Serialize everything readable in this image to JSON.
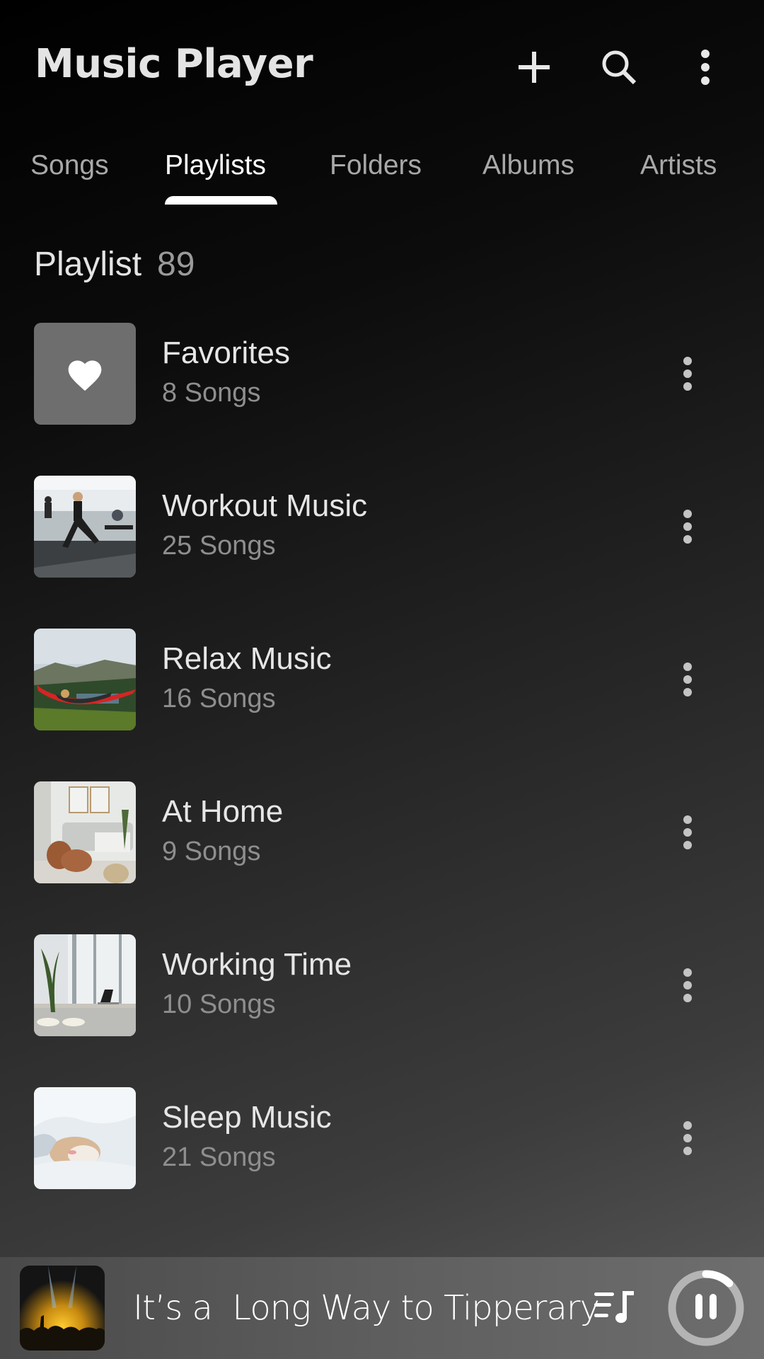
{
  "header": {
    "title": "Music Player",
    "actions": [
      {
        "name": "add",
        "icon": "plus-icon"
      },
      {
        "name": "search",
        "icon": "search-icon"
      },
      {
        "name": "more",
        "icon": "more-vert-icon"
      }
    ]
  },
  "tabs": [
    {
      "label": "Songs",
      "active": false
    },
    {
      "label": "Playlists",
      "active": true
    },
    {
      "label": "Folders",
      "active": false
    },
    {
      "label": "Albums",
      "active": false
    },
    {
      "label": "Artists",
      "active": false
    }
  ],
  "section": {
    "title": "Playlist",
    "count": "89"
  },
  "playlists": [
    {
      "title": "Favorites",
      "subtitle": "8 Songs",
      "art": "heart-icon"
    },
    {
      "title": "Workout Music",
      "subtitle": "25 Songs",
      "art": "workout-photo"
    },
    {
      "title": "Relax Music",
      "subtitle": "16 Songs",
      "art": "hammock-photo"
    },
    {
      "title": "At Home",
      "subtitle": "9 Songs",
      "art": "living-room-photo"
    },
    {
      "title": "Working Time",
      "subtitle": "10 Songs",
      "art": "office-photo"
    },
    {
      "title": "Sleep Music",
      "subtitle": "21 Songs",
      "art": "sleeping-cat-photo"
    }
  ],
  "now_playing": {
    "title": "It’s a  Long Way to Tipperary",
    "art": "concert-photo",
    "progress": 0.12,
    "state": "playing",
    "queue_icon": "queue-music-icon",
    "control_icon": "pause-icon"
  },
  "colors": {
    "accent": "#ffffff",
    "text_primary": "#e6e6e6",
    "text_secondary": "#8e8e8e",
    "tab_inactive": "#a8a8a8"
  }
}
